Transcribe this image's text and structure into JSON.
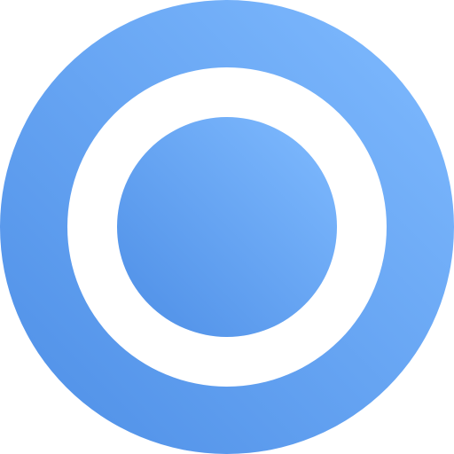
{
  "icon": {
    "name": "radio-button-icon",
    "colors": {
      "gradient_start": "#4d8ee6",
      "gradient_end": "#80bbff",
      "ring": "#ffffff"
    }
  }
}
